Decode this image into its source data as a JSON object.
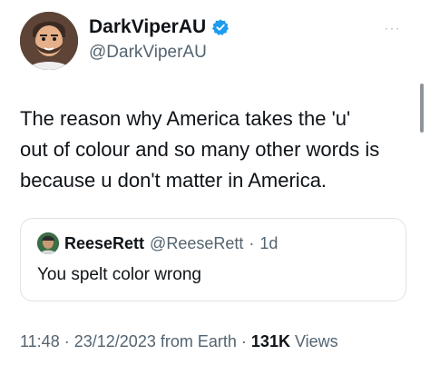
{
  "author": {
    "name": "DarkViperAU",
    "handle": "@DarkViperAU",
    "avatar_icon": "cartoon-avatar-icon",
    "verified_icon": "verified-badge-icon",
    "verified_color": "#1d9bf0"
  },
  "more_menu": {
    "label": "···"
  },
  "tweet": {
    "text": "The reason why America takes the 'u'\nout of colour and so many other words is\nbecause u don't matter in America."
  },
  "quote": {
    "name": "ReeseRett",
    "handle": "@ReeseRett",
    "separator": "·",
    "time": "1d",
    "text": "You spelt color wrong"
  },
  "meta": {
    "time": "11:48",
    "sep1": "·",
    "date": "23/12/2023",
    "source": "from Earth",
    "sep2": "·",
    "views_count": "131K",
    "views_label": "Views"
  },
  "colors": {
    "text_primary": "#0f1419",
    "text_secondary": "#536471",
    "border": "#dde3e7"
  }
}
